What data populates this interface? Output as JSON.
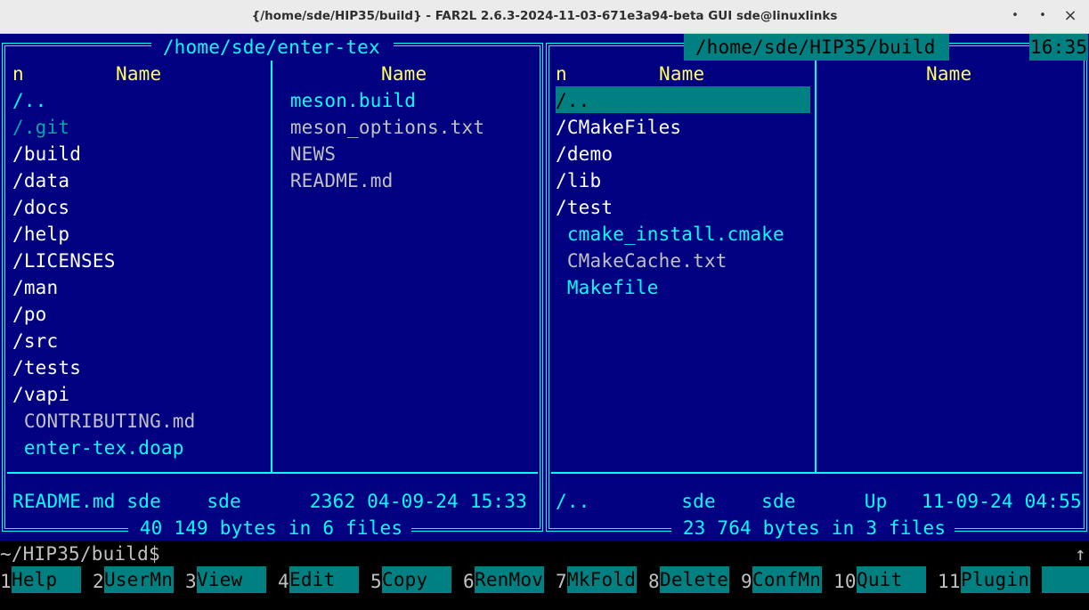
{
  "window": {
    "title": "{/home/sde/HIP35/build} - FAR2L 2.6.3-2024-11-03-671e3a94-beta GUI sde@linuxlinks",
    "minimize_glyph": "•",
    "maximize_glyph": "•",
    "close_glyph": "×"
  },
  "clock": "16:35",
  "left_panel": {
    "path": " /home/sde/enter-tex ",
    "col1_n": "n",
    "col1_header": "Name",
    "col2_header": "Name",
    "col1_items": [
      "/..",
      "/.git",
      "/build",
      "/data",
      "/docs",
      "/help",
      "/LICENSES",
      "/man",
      "/po",
      "/src",
      "/tests",
      "/vapi",
      " CONTRIBUTING.md",
      " enter-tex.doap"
    ],
    "col2_items": [
      " meson.build",
      " meson_options.txt",
      " NEWS",
      " README.md"
    ],
    "info": "README.md sde    sde      2362 04-09-24 15:33",
    "summary": " 40 149 bytes in 6 files "
  },
  "right_panel": {
    "path": " /home/sde/HIP35/build ",
    "col1_n": "n",
    "col1_header": "Name",
    "col2_header": "Name",
    "col1_items": [
      "/..",
      "/CMakeFiles",
      "/demo",
      "/lib",
      "/test",
      " cmake_install.cmake",
      " CMakeCache.txt",
      " Makefile"
    ],
    "info": "/..        sde    sde      Up   11-09-24 04:55",
    "summary": " 23 764 bytes in 3 files "
  },
  "command_line": {
    "prompt": "~/HIP35/build$",
    "scroll_icon": "↑"
  },
  "keybar": [
    {
      "num": "1",
      "label": "Help"
    },
    {
      "num": "2",
      "label": "UserMn"
    },
    {
      "num": "3",
      "label": "View"
    },
    {
      "num": "4",
      "label": "Edit"
    },
    {
      "num": "5",
      "label": "Copy"
    },
    {
      "num": "6",
      "label": "RenMov"
    },
    {
      "num": "7",
      "label": "MkFold"
    },
    {
      "num": "8",
      "label": "Delete"
    },
    {
      "num": "9",
      "label": "ConfMn"
    },
    {
      "num": "10",
      "label": "Quit"
    },
    {
      "num": "11",
      "label": "Plugin"
    },
    {
      "num": "",
      "label": ""
    }
  ],
  "colors": {
    "panel_bg": "#000080",
    "frame": "#00ffff",
    "header": "#ffff55",
    "folder": "#ffffff",
    "cyan_file": "#00ffff",
    "gray_file": "#c0c0c0",
    "selection_bg": "#008080"
  }
}
